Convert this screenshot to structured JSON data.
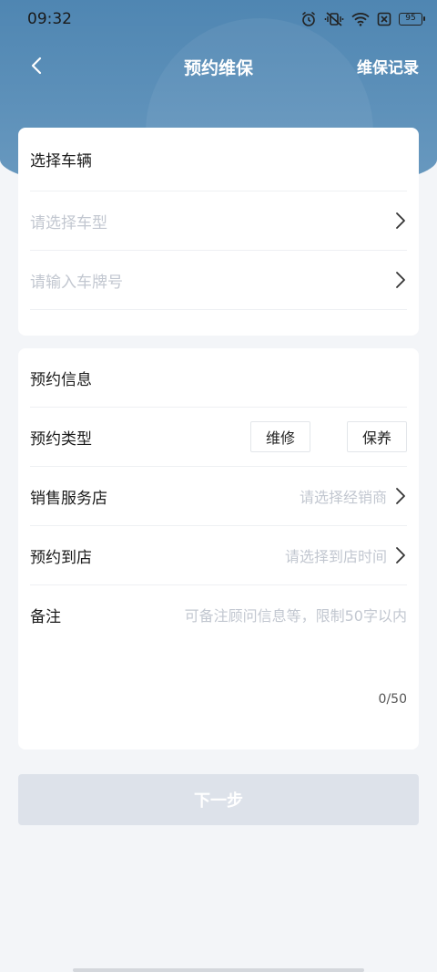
{
  "status_bar": {
    "time": "09:32",
    "battery": "95"
  },
  "nav": {
    "title": "预约维保",
    "right_label": "维保记录"
  },
  "vehicle_card": {
    "title": "选择车辆",
    "model_placeholder": "请选择车型",
    "plate_placeholder": "请输入车牌号"
  },
  "booking_card": {
    "title": "预约信息",
    "type_label": "预约类型",
    "type_options": [
      "维修",
      "保养"
    ],
    "dealer_label": "销售服务店",
    "dealer_placeholder": "请选择经销商",
    "arrival_label": "预约到店",
    "arrival_placeholder": "请选择到店时间",
    "remark_label": "备注",
    "remark_placeholder": "可备注顾问信息等，限制50字以内",
    "counter": "0/50"
  },
  "next_button": "下一步",
  "colors": {
    "header": "#5a8fb8",
    "disabled_button": "#dde2ea",
    "placeholder": "#c2c7d0"
  }
}
